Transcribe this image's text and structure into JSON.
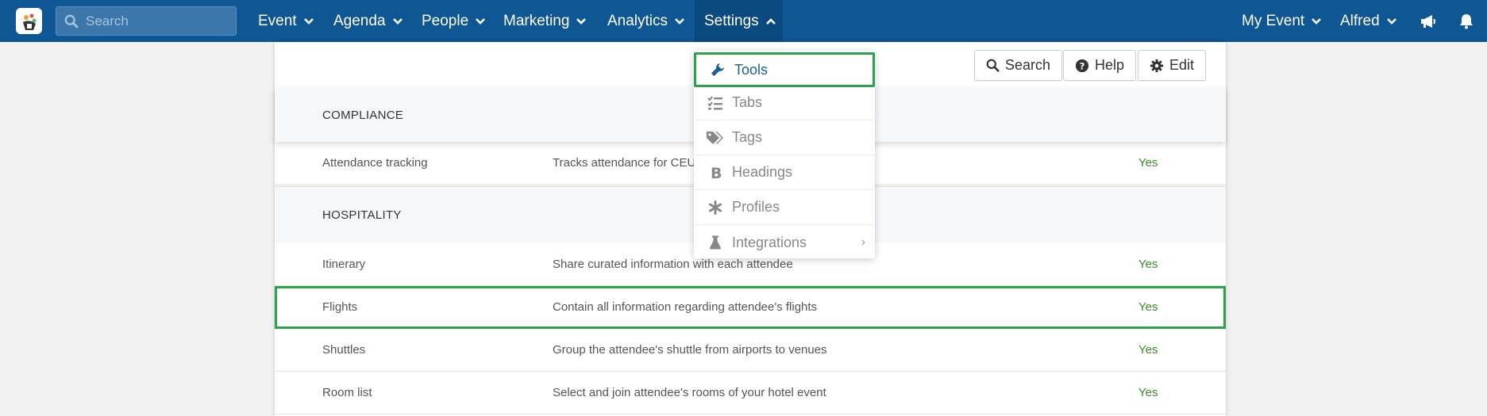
{
  "nav": {
    "search_placeholder": "Search",
    "menus": [
      {
        "label": "Event"
      },
      {
        "label": "Agenda"
      },
      {
        "label": "People"
      },
      {
        "label": "Marketing"
      },
      {
        "label": "Analytics"
      },
      {
        "label": "Settings",
        "active": true
      }
    ],
    "right": [
      {
        "label": "My Event"
      },
      {
        "label": "Alfred"
      }
    ],
    "icons": [
      "megaphone-icon",
      "bell-icon"
    ],
    "accent": "#0e5794"
  },
  "toolbar": {
    "search_label": "Search",
    "help_label": "Help",
    "edit_label": "Edit"
  },
  "settings_menu": {
    "items": [
      {
        "label": "Tools",
        "icon": "wrench-icon",
        "selected": true
      },
      {
        "label": "Tabs",
        "icon": "list-check-icon"
      },
      {
        "label": "Tags",
        "icon": "tags-icon"
      },
      {
        "label": "Headings",
        "icon": "bold-icon"
      },
      {
        "label": "Profiles",
        "icon": "asterisk-icon"
      },
      {
        "label": "Integrations",
        "icon": "flask-icon",
        "submenu_glyph": "›"
      }
    ]
  },
  "sections": [
    {
      "title": "COMPLIANCE",
      "rows": [
        {
          "name": "Attendance tracking",
          "description": "Tracks attendance for CEU",
          "enabled": "Yes"
        }
      ]
    },
    {
      "title": "HOSPITALITY",
      "rows": [
        {
          "name": "Itinerary",
          "description": "Share curated information with each attendee",
          "enabled": "Yes"
        },
        {
          "name": "Flights",
          "description": "Contain all information regarding attendee's flights",
          "enabled": "Yes",
          "highlighted": true
        },
        {
          "name": "Shuttles",
          "description": "Group the attendee's shuttle from airports to venues",
          "enabled": "Yes"
        },
        {
          "name": "Room list",
          "description": "Select and join attendee's rooms of your hotel event",
          "enabled": "Yes"
        }
      ]
    }
  ],
  "colors": {
    "yes_green": "#3c8a2e",
    "highlight_green": "#2ea24a"
  }
}
